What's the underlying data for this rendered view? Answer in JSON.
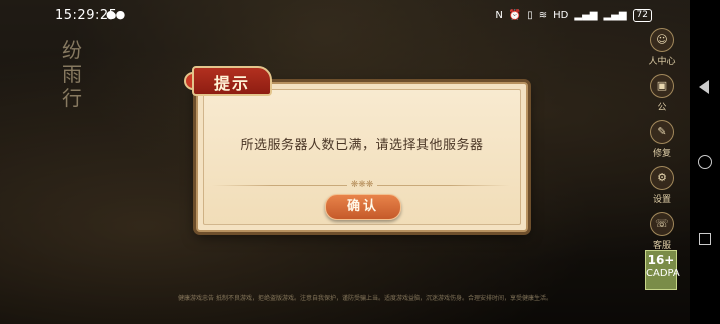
{
  "status_bar": {
    "time": "15:29:25",
    "wechat_icon": "wechat-icon",
    "icons": [
      "nfc-icon",
      "alarm-icon",
      "vibrate-icon",
      "wifi-icon",
      "hd-icon",
      "signal-icon",
      "signal-icon"
    ],
    "hd_label": "HD",
    "battery": "72"
  },
  "game": {
    "logo_text": "纷雨行",
    "side_menu": [
      {
        "icon": "person-icon",
        "label": "人中心"
      },
      {
        "icon": "gift-icon",
        "label": "公"
      },
      {
        "icon": "wrench-icon",
        "label": "修复"
      },
      {
        "icon": "settings-icon",
        "label": "设置"
      },
      {
        "icon": "service-icon",
        "label": "客服"
      }
    ],
    "age_badge": {
      "number": "16+",
      "label": "CADPA"
    },
    "footer_lines": [
      "健康游戏忠告 抵制不良游戏，拒绝盗版游戏。注意自我保护，谨防受骗上当。适度游戏益脑，沉迷游戏伤身。合理安排时间，享受健康生活。"
    ]
  },
  "dialog": {
    "title": "提示",
    "message": "所选服务器人数已满，请选择其他服务器",
    "confirm_label": "确认"
  },
  "colors": {
    "dialog_bg": "#f4e2c2",
    "title_red": "#a8281a",
    "button_orange": "#d86b38",
    "text_brown": "#4a3626"
  }
}
